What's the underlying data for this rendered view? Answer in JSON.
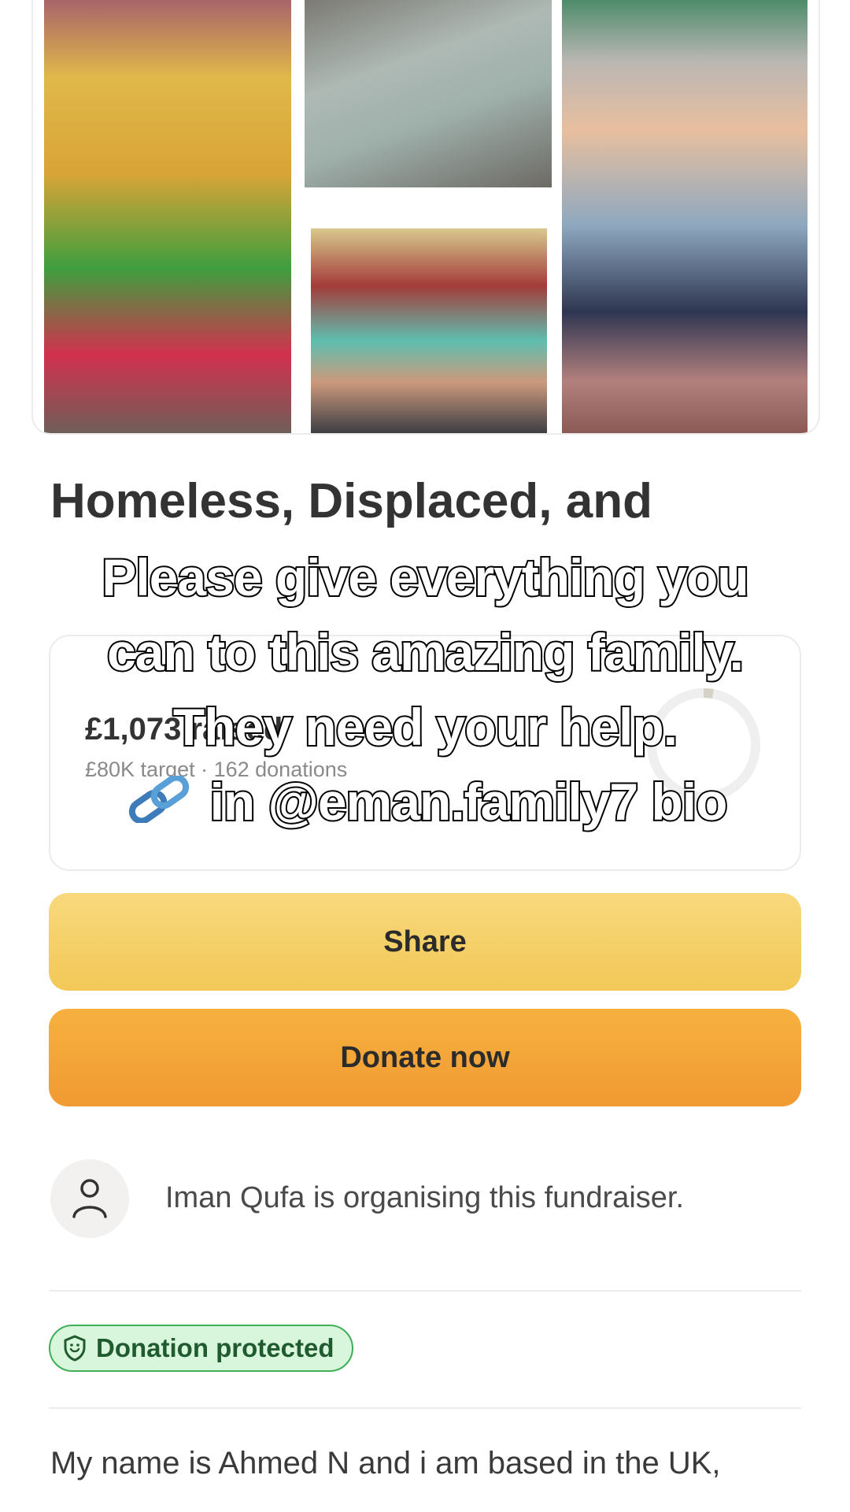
{
  "colors": {
    "share_button": "#f5d26a",
    "donate_button": "#f4a63a",
    "badge_background": "#d8f6dc",
    "badge_border": "#3fae57",
    "text_primary": "#333333",
    "caption_fill": "#ffffff",
    "caption_stroke": "#000000"
  },
  "campaign": {
    "title_line1": "Homeless, Displaced, and",
    "raised_amount": "£1,073 raised",
    "target_text": "£80K target · 162 donations"
  },
  "caption": {
    "line1": "Please give everything you",
    "line2": "can to this amazing family.",
    "line3": "They need your help.",
    "line4": "in @eman.family7 bio",
    "link_icon": "link-icon"
  },
  "actions": {
    "share_label": "Share",
    "donate_label": "Donate now"
  },
  "organiser": {
    "avatar_icon": "person-icon",
    "text": "Iman Qufa is organising this fundraiser."
  },
  "badge": {
    "icon": "shield-icon",
    "label": "Donation protected"
  },
  "story": {
    "first_line": "My name is Ahmed N and i am based in the UK,"
  }
}
